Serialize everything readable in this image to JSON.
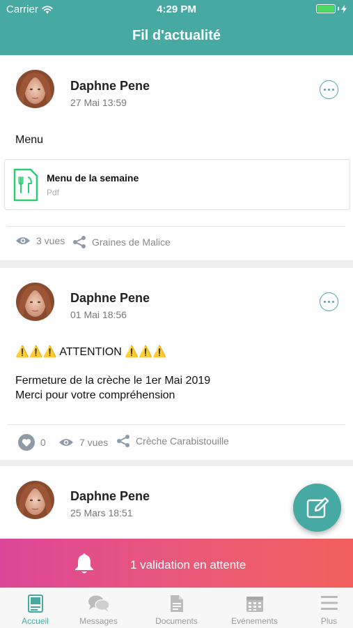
{
  "status_bar": {
    "carrier": "Carrier",
    "time": "4:29 PM"
  },
  "header": {
    "title": "Fil d'actualité"
  },
  "posts": [
    {
      "author": "Daphne Pene",
      "date": "27 Mai 13:59",
      "text": "Menu",
      "attachment": {
        "title": "Menu de la semaine",
        "type": "Pdf",
        "icon": "restaurant-document-icon"
      },
      "views": "3 vues",
      "group": "Graines de Malice"
    },
    {
      "author": "Daphne Pene",
      "date": "01 Mai 18:56",
      "text_line1": "⚠️⚠️⚠️ ATTENTION ⚠️⚠️⚠️",
      "text_line2": "Fermeture de la crèche le 1er Mai 2019",
      "text_line3": "Merci pour votre compréhension",
      "likes": "0",
      "views": "7 vues",
      "group": "Crèche Carabistouille"
    },
    {
      "author": "Daphne Pene",
      "date": "25 Mars 18:51"
    }
  ],
  "pending_banner": {
    "text": "1 validation en attente",
    "icon": "bell-icon"
  },
  "tabbar": {
    "items": [
      {
        "label": "Accueil",
        "icon": "home-feed-icon",
        "active": true
      },
      {
        "label": "Messages",
        "icon": "chat-bubbles-icon",
        "active": false
      },
      {
        "label": "Documents",
        "icon": "document-icon",
        "active": false
      },
      {
        "label": "Evénements",
        "icon": "calendar-icon",
        "active": false
      },
      {
        "label": "Plus",
        "icon": "menu-icon",
        "active": false
      }
    ]
  },
  "colors": {
    "accent": "#46a9a2",
    "banner_start": "#dc4698",
    "banner_end": "#f1605c",
    "attachment_icon": "#2ecc71"
  }
}
